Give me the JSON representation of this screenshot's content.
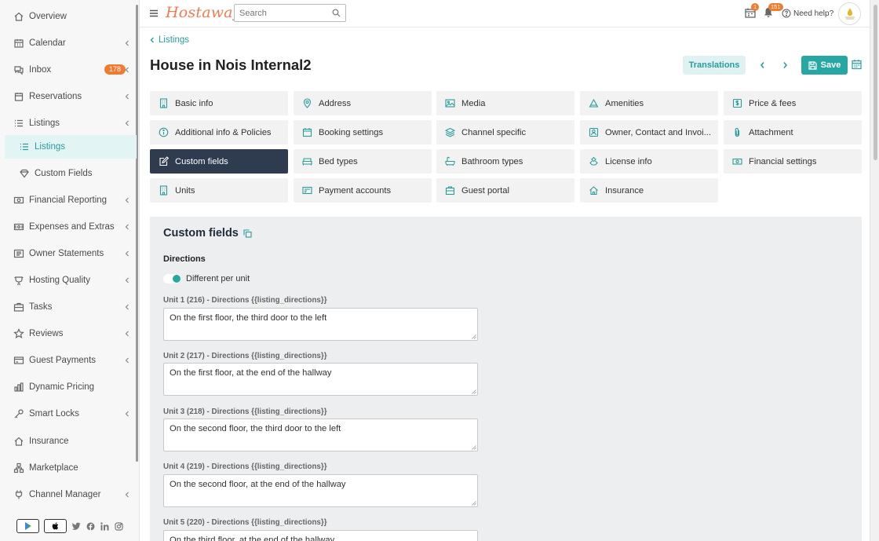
{
  "app": {
    "logo": "Hostaway"
  },
  "search": {
    "placeholder": "Search"
  },
  "topbar": {
    "calendar_badge": "1",
    "bell_badge": "151",
    "help_label": "Need help?"
  },
  "sidebar": {
    "items": [
      {
        "label": "Overview",
        "icon": "home-icon"
      },
      {
        "label": "Calendar",
        "icon": "calendar-icon"
      },
      {
        "label": "Inbox",
        "icon": "chat-icon",
        "badge": "178"
      },
      {
        "label": "Reservations",
        "icon": "reservation-icon"
      },
      {
        "label": "Listings",
        "icon": "list-icon"
      },
      {
        "label": "Listings",
        "icon": "list-icon"
      },
      {
        "label": "Custom Fields",
        "icon": "diamond-icon"
      },
      {
        "label": "Financial Reporting",
        "icon": "money-icon"
      },
      {
        "label": "Expenses and Extras",
        "icon": "wallet-icon"
      },
      {
        "label": "Owner Statements",
        "icon": "statement-icon"
      },
      {
        "label": "Hosting Quality",
        "icon": "trophy-icon"
      },
      {
        "label": "Tasks",
        "icon": "briefcase-icon"
      },
      {
        "label": "Reviews",
        "icon": "star-icon"
      },
      {
        "label": "Guest Payments",
        "icon": "card-icon"
      },
      {
        "label": "Dynamic Pricing",
        "icon": "bar-chart-icon"
      },
      {
        "label": "Smart Locks",
        "icon": "key-icon"
      },
      {
        "label": "Insurance",
        "icon": "home-shield-icon"
      },
      {
        "label": "Marketplace",
        "icon": "network-icon"
      },
      {
        "label": "Channel Manager",
        "icon": "plug-icon"
      }
    ]
  },
  "header": {
    "back_label": "Listings",
    "title": "House in Nois Internal2",
    "translations_label": "Translations",
    "save_label": "Save"
  },
  "tabs": [
    {
      "label": "Basic info",
      "icon": "building-icon"
    },
    {
      "label": "Address",
      "icon": "map-pin-icon"
    },
    {
      "label": "Media",
      "icon": "image-icon"
    },
    {
      "label": "Amenities",
      "icon": "triangle-icon"
    },
    {
      "label": "Price & fees",
      "icon": "dollar-icon"
    },
    {
      "label": "Additional info & Policies",
      "icon": "info-icon"
    },
    {
      "label": "Booking settings",
      "icon": "calendar-icon"
    },
    {
      "label": "Channel specific",
      "icon": "layers-icon"
    },
    {
      "label": "Owner, Contact and Invoi...",
      "icon": "contact-icon"
    },
    {
      "label": "Attachment",
      "icon": "paperclip-icon"
    },
    {
      "label": "Custom fields",
      "icon": "edit-icon"
    },
    {
      "label": "Bed types",
      "icon": "bed-icon"
    },
    {
      "label": "Bathroom types",
      "icon": "bathtub-icon"
    },
    {
      "label": "License info",
      "icon": "license-icon"
    },
    {
      "label": "Financial settings",
      "icon": "banknote-icon"
    },
    {
      "label": "Units",
      "icon": "building-icon"
    },
    {
      "label": "Payment accounts",
      "icon": "payment-card-icon"
    },
    {
      "label": "Guest portal",
      "icon": "portal-icon"
    },
    {
      "label": "Insurance",
      "icon": "home-shield-icon"
    }
  ],
  "panel": {
    "title": "Custom fields",
    "section_label": "Directions",
    "toggle_label": "Different per unit",
    "fields": [
      {
        "label": "Unit 1 (216) - Directions {{listing_directions}}",
        "value": "On the first floor, the third door to the left"
      },
      {
        "label": "Unit 2 (217) - Directions {{listing_directions}}",
        "value": "On the first floor, at the end of the hallway"
      },
      {
        "label": "Unit 3 (218) - Directions {{listing_directions}}",
        "value": "On the second floor, the third door to the left"
      },
      {
        "label": "Unit 4 (219) - Directions {{listing_directions}}",
        "value": "On the second floor, at the end of the hallway"
      },
      {
        "label": "Unit 5 (220) - Directions {{listing_directions}}",
        "value": "On the third floor, at the end of the hallway"
      }
    ]
  },
  "colors": {
    "accent": "#27a7a3",
    "active_tab": "#2f3b4f",
    "badge": "#f07b2e",
    "logo": "#f07b52"
  }
}
